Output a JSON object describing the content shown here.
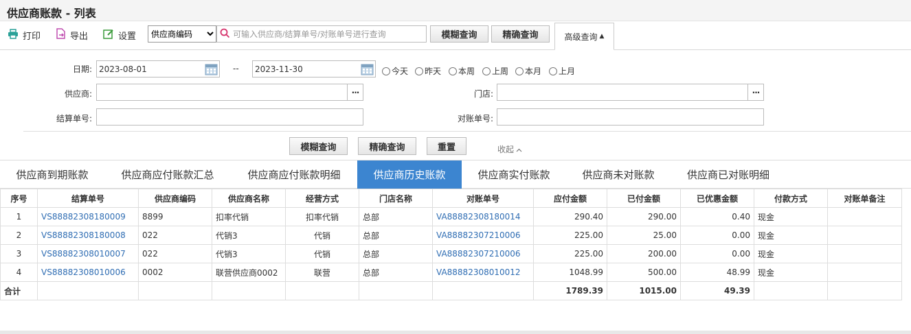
{
  "title": "供应商账款 - 列表",
  "toolbar": {
    "print": "打印",
    "export": "导出",
    "settings": "设置",
    "field_select": "供应商编码",
    "search_placeholder": "可输入供应商/结算单号/对账单号进行查询",
    "fuzzy": "模糊查询",
    "exact": "精确查询",
    "advanced": "高级查询"
  },
  "form": {
    "date_label": "日期:",
    "date_from": "2023-08-01",
    "date_sep": "--",
    "date_to": "2023-11-30",
    "quick": [
      "今天",
      "昨天",
      "本周",
      "上周",
      "本月",
      "上月"
    ],
    "supplier_label": "供应商:",
    "store_label": "门店:",
    "settle_label": "结算单号:",
    "recon_label": "对账单号:",
    "fuzzy": "模糊查询",
    "exact": "精确查询",
    "reset": "重置",
    "collapse": "收起"
  },
  "tabs": [
    "供应商到期账款",
    "供应商应付账款汇总",
    "供应商应付账款明细",
    "供应商历史账款",
    "供应商实付账款",
    "供应商未对账款",
    "供应商已对账明细"
  ],
  "active_tab": "供应商历史账款",
  "table": {
    "headers": [
      "序号",
      "结算单号",
      "供应商编码",
      "供应商名称",
      "经营方式",
      "门店名称",
      "对账单号",
      "应付金额",
      "已付金额",
      "已优惠金额",
      "付款方式",
      "对账单备注"
    ],
    "rows": [
      [
        "1",
        "VS88882308180009",
        "8899",
        "扣率代销",
        "扣率代销",
        "总部",
        "VA88882308180014",
        "290.40",
        "290.00",
        "0.40",
        "现金",
        ""
      ],
      [
        "2",
        "VS88882308180008",
        "022",
        "代销3",
        "代销",
        "总部",
        "VA88882307210006",
        "225.00",
        "25.00",
        "0.00",
        "现金",
        ""
      ],
      [
        "3",
        "VS88882308010007",
        "022",
        "代销3",
        "代销",
        "总部",
        "VA88882307210006",
        "225.00",
        "200.00",
        "0.00",
        "现金",
        ""
      ],
      [
        "4",
        "VS88882308010006",
        "0002",
        "联营供应商0002",
        "联营",
        "总部",
        "VA88882308010012",
        "1048.99",
        "500.00",
        "48.99",
        "现金",
        ""
      ]
    ],
    "total": [
      "合计",
      "",
      "",
      "",
      "",
      "",
      "",
      "1789.39",
      "1015.00",
      "49.39",
      "",
      ""
    ]
  },
  "colors": {
    "accent": "#3c85d0",
    "link": "#2f6db3"
  }
}
